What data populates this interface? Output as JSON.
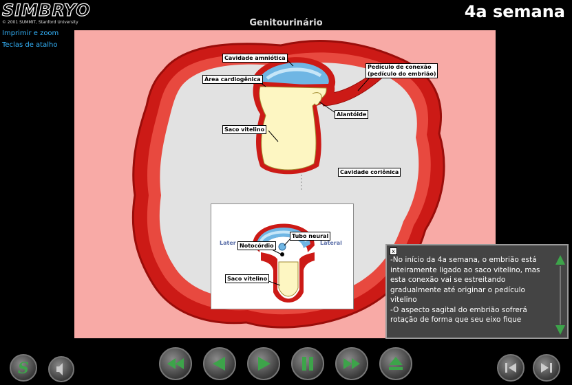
{
  "header": {
    "logo_text": "SIMBRYO",
    "copyright": "© 2001 SUMMIT, Stanford University",
    "week_title": "4a semana",
    "section_title": "Genitourinário"
  },
  "sidebar": {
    "links": [
      {
        "label": "Imprimir e zoom"
      },
      {
        "label": "Teclas de atalho"
      }
    ]
  },
  "diagram": {
    "labels": {
      "amniotic": "Cavidade amniótica",
      "connecting_stalk_1": "Pedículo de conexão",
      "connecting_stalk_2": "(pedículo do embrião)",
      "cardiogenic": "Área cardiogênica",
      "allantois": "Alantóide",
      "yolk_sac": "Saco vitelino",
      "chorionic": "Cavidade coriônica"
    },
    "inset": {
      "lateral_left": "Later",
      "lateral_right": "Lateral",
      "neural_tube": "Tubo neural",
      "notochord": "Notocórdio",
      "yolk_sac": "Saco vitelino"
    },
    "colors": {
      "background": "#f8aaa6",
      "wall": "#cc1a16",
      "cavity": "#e2e2e2",
      "yolk": "#fdf6c2",
      "amnion": "#6fb6e4"
    }
  },
  "text_panel": {
    "close_label": "x",
    "paragraphs": [
      "-No início da 4a semana, o embrião está inteiramente ligado ao saco vitelino, mas esta conexão vai se estreitando gradualmente até originar o pedículo vitelino",
      "-O aspecto sagital do embrião sofrerá rotação de forma que seu eixo fique"
    ]
  },
  "controls": {
    "buttons": [
      "summary",
      "sound",
      "rewind",
      "step-back",
      "play",
      "pause",
      "fast-forward",
      "eject",
      "previous",
      "next"
    ]
  }
}
